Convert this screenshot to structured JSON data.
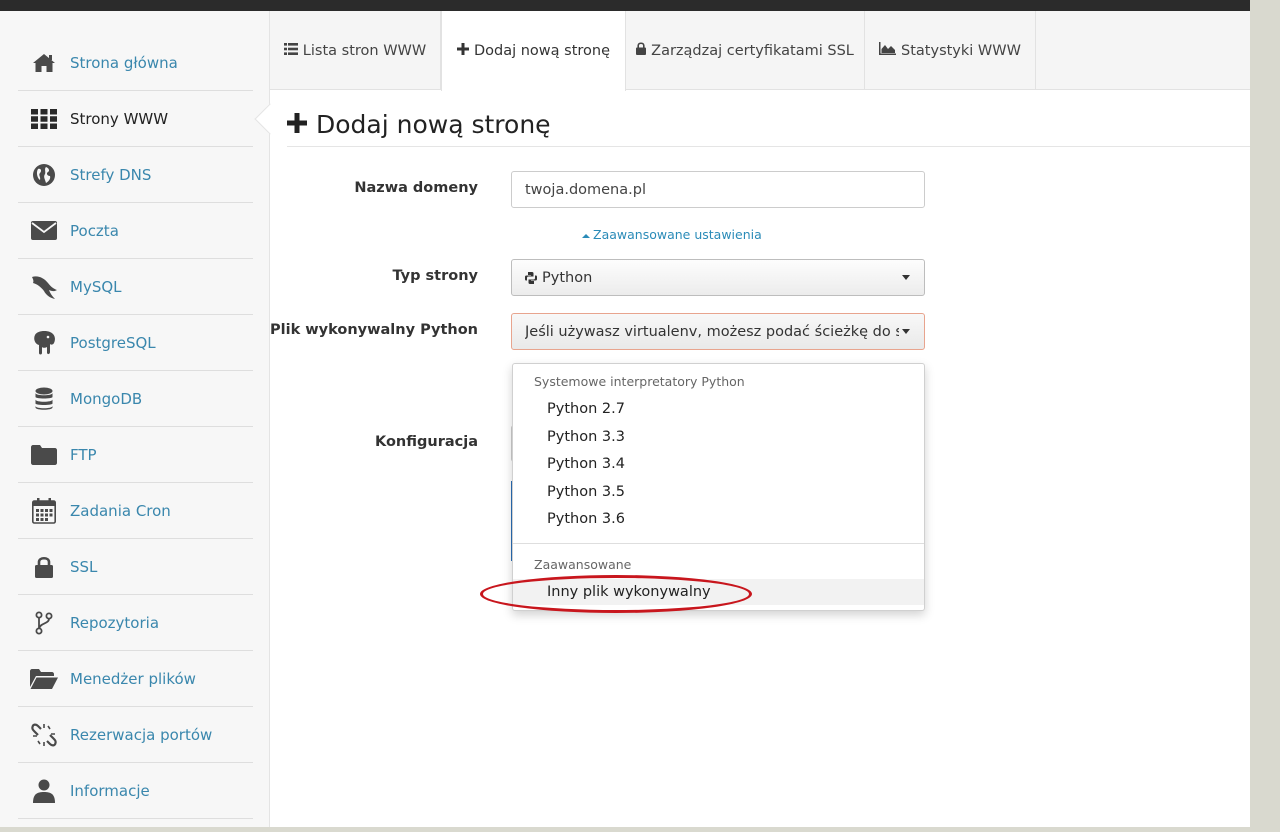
{
  "sidebar": {
    "items": [
      {
        "label": "Strona główna",
        "icon": "home-icon"
      },
      {
        "label": "Strony WWW",
        "icon": "grid-icon"
      },
      {
        "label": "Strefy DNS",
        "icon": "globe-icon"
      },
      {
        "label": "Poczta",
        "icon": "envelope-icon"
      },
      {
        "label": "MySQL",
        "icon": "dolphin-icon"
      },
      {
        "label": "PostgreSQL",
        "icon": "elephant-icon"
      },
      {
        "label": "MongoDB",
        "icon": "database-icon"
      },
      {
        "label": "FTP",
        "icon": "folder-icon"
      },
      {
        "label": "Zadania Cron",
        "icon": "calendar-icon"
      },
      {
        "label": "SSL",
        "icon": "lock-icon"
      },
      {
        "label": "Repozytoria",
        "icon": "branch-icon"
      },
      {
        "label": "Menedżer plików",
        "icon": "folder-open-icon"
      },
      {
        "label": "Rezerwacja portów",
        "icon": "broken-link-icon"
      },
      {
        "label": "Informacje",
        "icon": "user-icon"
      }
    ],
    "active_index": 1
  },
  "tabs": [
    {
      "label": "Lista stron WWW",
      "icon": "list-icon"
    },
    {
      "label": "Dodaj nową stronę",
      "icon": "plus-icon"
    },
    {
      "label": "Zarządzaj certyfikatami SSL",
      "icon": "lock-icon"
    },
    {
      "label": "Statystyki WWW",
      "icon": "area-chart-icon"
    }
  ],
  "page": {
    "title": "Dodaj nową stronę"
  },
  "form": {
    "domain_label": "Nazwa domeny",
    "domain_placeholder": "twoja.domena.pl",
    "advanced_link": "Zaawansowane ustawienia",
    "type_label": "Typ strony",
    "type_value": "Python",
    "exec_label": "Plik wykonywalny Python",
    "exec_value": "Jeśli używasz virtualenv, możesz podać ścieżkę do swo",
    "config_label": "Konfiguracja"
  },
  "dropdown": {
    "group1_header": "Systemowe interpretatory Python",
    "group1_items": [
      "Python 2.7",
      "Python 3.3",
      "Python 3.4",
      "Python 3.5",
      "Python 3.6"
    ],
    "group2_header": "Zaawansowane",
    "group2_items": [
      "Inny plik wykonywalny"
    ]
  },
  "colors": {
    "link": "#3a87ad",
    "highlight_ellipse": "#c8161d",
    "open_select_border": "#e8a48e"
  }
}
